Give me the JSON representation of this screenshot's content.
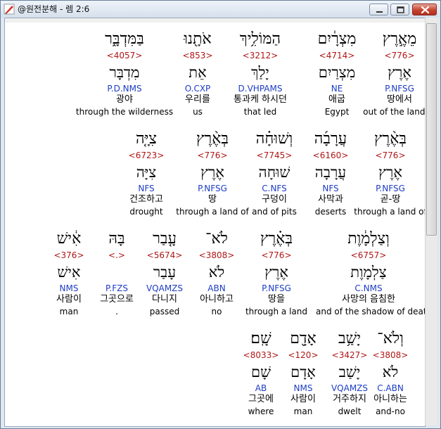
{
  "window": {
    "title": "@원전분해 - 렘 2:6",
    "buttons": {
      "minimize": "minimize",
      "maximize": "maximize",
      "close": "close"
    }
  },
  "colors": {
    "strong": "#b01616",
    "morph": "#1d3cc4",
    "text": "#000000",
    "close_button": "#c6432f"
  },
  "rows": [
    {
      "words": [
        {
          "heb": "מֵאֶ֣רֶץ",
          "strong": "<776>",
          "lemma": "אֶרֶץ",
          "morph": "P.NFSG",
          "kor": "땅에서",
          "eng": "out of the land of"
        },
        {
          "heb": "מִצְרָ֔יִם",
          "strong": "<4714>",
          "lemma": "מִצְרַיִם",
          "morph": "NE",
          "kor": "애굽",
          "eng": "Egypt"
        },
        {
          "heb": "הַמּוֹלִ֥יךְ",
          "strong": "<3212>",
          "lemma": "יָלַךְ",
          "morph": "D.VHPAMS",
          "kor": "통과케 하시던",
          "eng": "that led"
        },
        {
          "heb": "אֹתָ֖נוּ",
          "strong": "<853>",
          "lemma": "אֵת",
          "morph": "O.CXP",
          "kor": "우리를",
          "eng": "us"
        },
        {
          "heb": "בַּמִּדְבָּ֑ר",
          "strong": "<4057>",
          "lemma": "מִדְבָּר",
          "morph": "P.D.NMS",
          "kor": "광야",
          "eng": "through the wilderness"
        }
      ]
    },
    {
      "words": [
        {
          "heb": "בְּאֶ֨רֶץ",
          "strong": "<776>",
          "lemma": "אֶרֶץ",
          "morph": "P.NFSG",
          "kor": "곧-땅",
          "eng": "through a land of"
        },
        {
          "heb": "עֲרָבָ֜ה",
          "strong": "<6160>",
          "lemma": "עֲרָבָה",
          "morph": "NFS",
          "kor": "사막과",
          "eng": "deserts"
        },
        {
          "heb": "וְשׁוּחָ֗ה",
          "strong": "<7745>",
          "lemma": "שׁוּחָה",
          "morph": "C.NFS",
          "kor": "구덩이",
          "eng": "and of pits"
        },
        {
          "heb": "בְּאֶ֨רֶץ",
          "strong": "<776>",
          "lemma": "אֶרֶץ",
          "morph": "P.NFSG",
          "kor": "땅",
          "eng": "through a land of"
        },
        {
          "heb": "צִיָּ֤ה",
          "strong": "<6723>",
          "lemma": "צִיָּה",
          "morph": "NFS",
          "kor": "건조하고",
          "eng": "drought"
        }
      ]
    },
    {
      "words": [
        {
          "heb": "וְצַלְמָ֔וֶת",
          "strong": "<6757>",
          "lemma": "צַלְמָוֶת",
          "morph": "C.NMS",
          "kor": "사망의 음침한",
          "eng": "and of the shadow of death"
        },
        {
          "heb": "בְּאֶ֗רֶץ",
          "strong": "<776>",
          "lemma": "אֶרֶץ",
          "morph": "P.NFSG",
          "kor": "땅을",
          "eng": "through a land"
        },
        {
          "heb": "לֹא־",
          "strong": "<3808>",
          "lemma": "לֹא",
          "morph": "ABN",
          "kor": "아니하고",
          "eng": "no"
        },
        {
          "heb": "עָ֤בַר",
          "strong": "<5674>",
          "lemma": "עָבַר",
          "morph": "VQAMZS",
          "kor": "다니지",
          "eng": "passed"
        },
        {
          "heb": "בָּהּ",
          "strong": "<.>",
          "lemma": "",
          "morph": "P.FZS",
          "kor": "그곳으로",
          "eng": "."
        },
        {
          "heb": "אִ֔ישׁ",
          "strong": "<376>",
          "lemma": "אִישׁ",
          "morph": "NMS",
          "kor": "사람이",
          "eng": "man"
        }
      ]
    },
    {
      "words": [
        {
          "heb": "וְלֹא־",
          "strong": "<3808>",
          "lemma": "לֹא",
          "morph": "C.ABN",
          "kor": "아니하는",
          "eng": "and-no"
        },
        {
          "heb": "יָשַׁ֥ב",
          "strong": "<3427>",
          "lemma": "יָשַׁב",
          "morph": "VQAMZS",
          "kor": "거주하지",
          "eng": "dwelt"
        },
        {
          "heb": "אָדָ֖ם",
          "strong": "<120>",
          "lemma": "אָדָם",
          "morph": "NMS",
          "kor": "사람이",
          "eng": "man"
        },
        {
          "heb": "שָֽׁם׃",
          "strong": "<8033>",
          "lemma": "שָׁם",
          "morph": "AB",
          "kor": "그곳에",
          "eng": "where"
        }
      ]
    }
  ]
}
